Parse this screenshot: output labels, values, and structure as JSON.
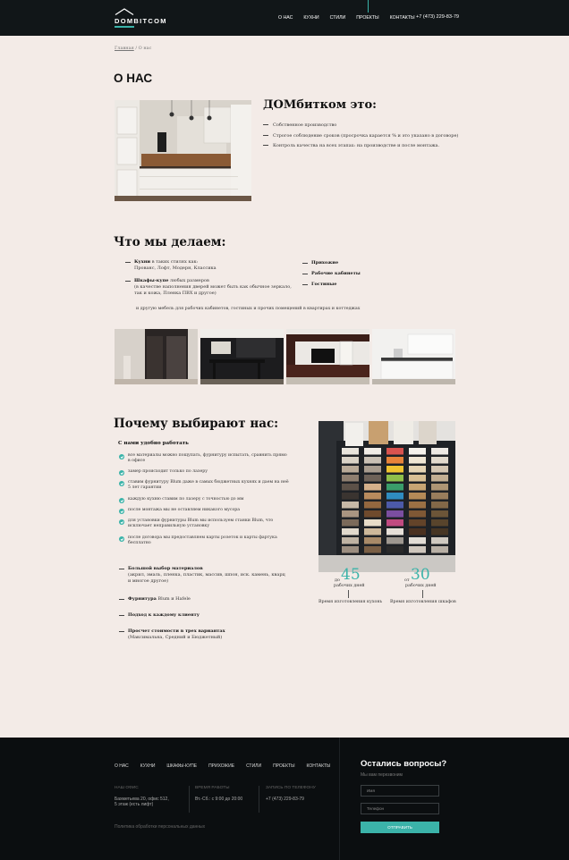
{
  "header": {
    "logo": "DOMBITCOM",
    "nav": [
      "О НАС",
      "КУХНИ",
      "СТИЛИ",
      "ПРОЕКТЫ",
      "КОНТАКТЫ"
    ],
    "active_nav": "ПРОЕКТЫ",
    "phone": "+7 (473) 229-83-79"
  },
  "breadcrumb": {
    "home": "Главная",
    "sep": " / ",
    "current": "О нас"
  },
  "page_title": "О НАС",
  "about": {
    "heading": "ДОМбитком это:",
    "items": [
      "Собственное производство",
      "Строгое соблюдение сроков (просрочка карается % и это указано в договоре)",
      "Контроль качества на всех этапах: на производстве и после монтажа."
    ]
  },
  "what_we_do": {
    "heading": "Что мы делаем:",
    "kitchens_title": "Кухни",
    "kitchens_text1": " в таких стилях как:",
    "kitchens_text2": "Прованс, Лофт, Модерн, Классика",
    "wardrobes_title": "Шкафы-купе",
    "wardrobes_text1": " любых размеров",
    "wardrobes_text2": "(в качестве наполнения дверей может быть как обычное зеркало,",
    "wardrobes_text3": "так и кожа, Пленка ПВХ и другое)",
    "right_items": [
      "Прихожие",
      "Рабочие кабинеты",
      "Гостиные"
    ],
    "note": "и другую мебель для рабочих кабинетов, гостиных и прочих помещений в квартирах и коттеджах"
  },
  "why": {
    "heading": "Почему выбирают нас:",
    "subheading": "С нами удобно работать",
    "checks": [
      [
        "все материалы можно пощупать, фурнитуру испытать, сравнить прямо",
        "в офисе"
      ],
      [
        "замер происходит только по лазеру"
      ],
      [
        "ставим фурнитуру Blum даже в самых бюджетных кухнях и даем на неё",
        "5 лет гарантии"
      ],
      [
        "каждую кухню ставим по лазеру с точностью до мм"
      ],
      [
        "после монтажа мы не оставляем никакого мусора"
      ],
      [
        "для установки фурнитуры Blum мы используем станки Blum, что",
        "исключает неправильную установку"
      ],
      [
        "после договора мы предоставляем карты розеток и карты фартука",
        "бесплатно"
      ]
    ],
    "b1_title": "Большой выбор материалов",
    "b1_text1": "(акрил, эмаль, пленка, пластик, массив, шпон, иск. камень, кварц",
    "b1_text2": "и многое другое)",
    "b2_title": "Фурнитура",
    "b2_text": " Blum и Hafele",
    "b3_title": "Подход к каждому клиенту",
    "b4_title": "Просчет стоимости в трех вариантах",
    "b4_text": "(Максимальна, Средний и Бюджетный)",
    "stat1_prefix": "до",
    "stat1_value": "45",
    "stat1_unit": "рабочих дней",
    "stat1_caption": "Время изготовления кухонь",
    "stat2_prefix": "от",
    "stat2_value": "30",
    "stat2_unit": "рабочих дней",
    "stat2_caption": "Время изготовления шкафов"
  },
  "footer": {
    "nav": [
      "О НАС",
      "КУХНИ",
      "ШКАФЫ-КУПЕ",
      "ПРИХОЖИЕ",
      "СТИЛИ",
      "ПРОЕКТЫ",
      "КОНТАКТЫ"
    ],
    "office_label": "НАШ ОФИС",
    "office_line1": "Бахметьева 20, офис 512,",
    "office_line2": "5 этаж (есть лифт)",
    "hours_label": "ВРЕМЯ РАБОТЫ",
    "hours": "Вт.-Сб.: с 9:00 до 20:00",
    "call_label": "ЗАПИСЬ ПО ТЕЛЕФОНУ",
    "call": "+7 (473) 229-83-79",
    "policy": "Политика обработки персональных данных",
    "form_title": "Остались вопросы?",
    "form_subtitle": "Мы вам перезвоним",
    "name_placeholder": "Имя",
    "phone_placeholder": "Телефон",
    "submit": "ОТПРАВИТЬ"
  },
  "colors": {
    "accent": "#3bb3a9",
    "header_bg": "#111618",
    "footer_bg": "#0b0e10",
    "page_bg": "#f3ebe7"
  }
}
